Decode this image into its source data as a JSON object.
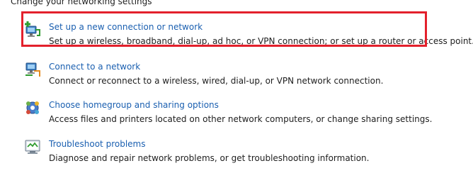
{
  "section": {
    "heading": "Change your networking settings"
  },
  "tasks": [
    {
      "icon": "new-connection-icon",
      "link": "Set up a new connection or network",
      "description": "Set up a wireless, broadband, dial-up, ad hoc, or VPN connection; or set up a router or access point."
    },
    {
      "icon": "connect-network-icon",
      "link": "Connect to a network",
      "description": "Connect or reconnect to a wireless, wired, dial-up, or VPN network connection."
    },
    {
      "icon": "homegroup-icon",
      "link": "Choose homegroup and sharing options",
      "description": "Access files and printers located on other network computers, or change sharing settings."
    },
    {
      "icon": "troubleshoot-icon",
      "link": "Troubleshoot problems",
      "description": "Diagnose and repair network problems, or get troubleshooting information."
    }
  ],
  "colors": {
    "link": "#1a5fb0",
    "text": "#1e1e1e",
    "highlight": "#e3202c"
  }
}
